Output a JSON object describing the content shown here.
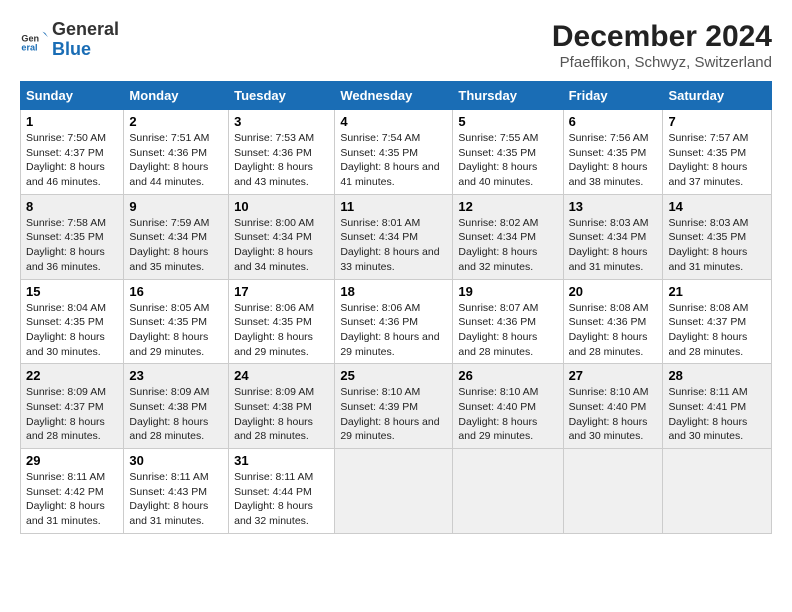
{
  "header": {
    "logo_line1": "General",
    "logo_line2": "Blue",
    "title": "December 2024",
    "subtitle": "Pfaeffikon, Schwyz, Switzerland"
  },
  "calendar": {
    "days_of_week": [
      "Sunday",
      "Monday",
      "Tuesday",
      "Wednesday",
      "Thursday",
      "Friday",
      "Saturday"
    ],
    "weeks": [
      [
        null,
        {
          "day": 2,
          "sunrise": "7:51 AM",
          "sunset": "4:36 PM",
          "daylight": "8 hours and 44 minutes."
        },
        {
          "day": 3,
          "sunrise": "7:53 AM",
          "sunset": "4:36 PM",
          "daylight": "8 hours and 43 minutes."
        },
        {
          "day": 4,
          "sunrise": "7:54 AM",
          "sunset": "4:35 PM",
          "daylight": "8 hours and 41 minutes."
        },
        {
          "day": 5,
          "sunrise": "7:55 AM",
          "sunset": "4:35 PM",
          "daylight": "8 hours and 40 minutes."
        },
        {
          "day": 6,
          "sunrise": "7:56 AM",
          "sunset": "4:35 PM",
          "daylight": "8 hours and 38 minutes."
        },
        {
          "day": 7,
          "sunrise": "7:57 AM",
          "sunset": "4:35 PM",
          "daylight": "8 hours and 37 minutes."
        }
      ],
      [
        {
          "day": 1,
          "sunrise": "7:50 AM",
          "sunset": "4:37 PM",
          "daylight": "8 hours and 46 minutes."
        },
        {
          "day": 9,
          "sunrise": "7:59 AM",
          "sunset": "4:34 PM",
          "daylight": "8 hours and 35 minutes."
        },
        {
          "day": 10,
          "sunrise": "8:00 AM",
          "sunset": "4:34 PM",
          "daylight": "8 hours and 34 minutes."
        },
        {
          "day": 11,
          "sunrise": "8:01 AM",
          "sunset": "4:34 PM",
          "daylight": "8 hours and 33 minutes."
        },
        {
          "day": 12,
          "sunrise": "8:02 AM",
          "sunset": "4:34 PM",
          "daylight": "8 hours and 32 minutes."
        },
        {
          "day": 13,
          "sunrise": "8:03 AM",
          "sunset": "4:34 PM",
          "daylight": "8 hours and 31 minutes."
        },
        {
          "day": 14,
          "sunrise": "8:03 AM",
          "sunset": "4:35 PM",
          "daylight": "8 hours and 31 minutes."
        }
      ],
      [
        {
          "day": 8,
          "sunrise": "7:58 AM",
          "sunset": "4:35 PM",
          "daylight": "8 hours and 36 minutes."
        },
        {
          "day": 16,
          "sunrise": "8:05 AM",
          "sunset": "4:35 PM",
          "daylight": "8 hours and 29 minutes."
        },
        {
          "day": 17,
          "sunrise": "8:06 AM",
          "sunset": "4:35 PM",
          "daylight": "8 hours and 29 minutes."
        },
        {
          "day": 18,
          "sunrise": "8:06 AM",
          "sunset": "4:36 PM",
          "daylight": "8 hours and 29 minutes."
        },
        {
          "day": 19,
          "sunrise": "8:07 AM",
          "sunset": "4:36 PM",
          "daylight": "8 hours and 28 minutes."
        },
        {
          "day": 20,
          "sunrise": "8:08 AM",
          "sunset": "4:36 PM",
          "daylight": "8 hours and 28 minutes."
        },
        {
          "day": 21,
          "sunrise": "8:08 AM",
          "sunset": "4:37 PM",
          "daylight": "8 hours and 28 minutes."
        }
      ],
      [
        {
          "day": 15,
          "sunrise": "8:04 AM",
          "sunset": "4:35 PM",
          "daylight": "8 hours and 30 minutes."
        },
        {
          "day": 23,
          "sunrise": "8:09 AM",
          "sunset": "4:38 PM",
          "daylight": "8 hours and 28 minutes."
        },
        {
          "day": 24,
          "sunrise": "8:09 AM",
          "sunset": "4:38 PM",
          "daylight": "8 hours and 28 minutes."
        },
        {
          "day": 25,
          "sunrise": "8:10 AM",
          "sunset": "4:39 PM",
          "daylight": "8 hours and 29 minutes."
        },
        {
          "day": 26,
          "sunrise": "8:10 AM",
          "sunset": "4:40 PM",
          "daylight": "8 hours and 29 minutes."
        },
        {
          "day": 27,
          "sunrise": "8:10 AM",
          "sunset": "4:40 PM",
          "daylight": "8 hours and 30 minutes."
        },
        {
          "day": 28,
          "sunrise": "8:11 AM",
          "sunset": "4:41 PM",
          "daylight": "8 hours and 30 minutes."
        }
      ],
      [
        {
          "day": 22,
          "sunrise": "8:09 AM",
          "sunset": "4:37 PM",
          "daylight": "8 hours and 28 minutes."
        },
        {
          "day": 30,
          "sunrise": "8:11 AM",
          "sunset": "4:43 PM",
          "daylight": "8 hours and 31 minutes."
        },
        {
          "day": 31,
          "sunrise": "8:11 AM",
          "sunset": "4:44 PM",
          "daylight": "8 hours and 32 minutes."
        },
        null,
        null,
        null,
        null
      ],
      [
        {
          "day": 29,
          "sunrise": "8:11 AM",
          "sunset": "4:42 PM",
          "daylight": "8 hours and 31 minutes."
        },
        null,
        null,
        null,
        null,
        null,
        null
      ]
    ]
  }
}
